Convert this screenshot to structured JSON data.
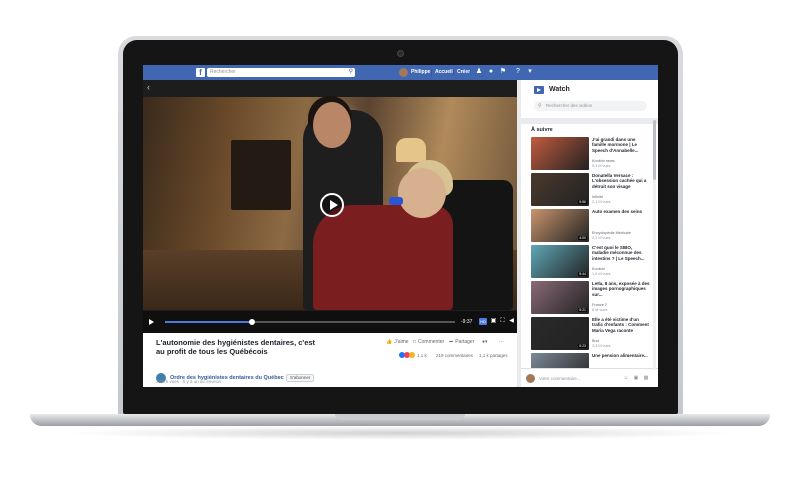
{
  "topbar": {
    "logo": "f",
    "search_placeholder": "Rechercher",
    "user_name": "Philippe",
    "home_label": "Accueil",
    "create_label": "Créer"
  },
  "player": {
    "time_remaining": "-9:37",
    "progress": 0.3
  },
  "video": {
    "title": "L'autonomie des hygiénistes dentaires, c'est au profit de tous les Québécois",
    "like_label": "J'aime",
    "comment_label": "Commenter",
    "share_label": "Partager",
    "reactions_count": "1,1 k",
    "comments_count": "219 commentaires",
    "shares_count": "1,1 k partages",
    "page_name": "Ordre des hygiénistes dentaires du Québec",
    "subscribe_label": "S'abonner",
    "meta": "22,8 k vues · Il y a un an environ · "
  },
  "watch": {
    "title": "Watch",
    "search_placeholder": "Rechercher des vidéos",
    "next_label": "À suivre",
    "comment_placeholder": "Votre commentaire..."
  },
  "up_next": [
    {
      "title": "J'ai grandi dans une famille mormone | Le Speech d'Annabelle...",
      "source": "Konbini news",
      "views": "5,3 M vues",
      "duration": "",
      "thumb": "#c25b3f"
    },
    {
      "title": "Donatella Versace : L'obsession cachée qui a détruit son visage",
      "source": "Infinite",
      "views": "2,1 M vues",
      "duration": "5:56",
      "thumb": "#4a3a2e"
    },
    {
      "title": "Auto examen des seins",
      "source": "Encyclopédie Médicale",
      "views": "2,1 M vues",
      "duration": "4:00",
      "thumb": "#c9956d"
    },
    {
      "title": "C'est quoi le SIBO, maladie méconnue des intestins ? | Le Speech...",
      "source": "Konbini",
      "views": "1,9 M vues",
      "duration": "5:44",
      "thumb": "#5fa8b8"
    },
    {
      "title": "Leïla, 8 ans, exposée à des images pornographiques sur...",
      "source": "France 2",
      "views": "8 M vues",
      "duration": "5:21",
      "thumb": "#8a6a78"
    },
    {
      "title": "Elle a été victime d'un trafic d'enfants : Comment Maria Vega raconte",
      "source": "Brut",
      "views": "3,3 M vues",
      "duration": "5:23",
      "thumb": "#2a2a2a"
    },
    {
      "title": "Une pension alimentaire...",
      "source": "",
      "views": "",
      "duration": "",
      "thumb": "#7c8a99"
    }
  ],
  "colors": {
    "facebook_blue": "#4267b2",
    "link_blue": "#365899",
    "progress_blue": "#4a7be0"
  },
  "icons": {
    "topbar": [
      "friends-icon",
      "messenger-icon",
      "notifications-icon",
      "help-icon",
      "dropdown-icon"
    ],
    "controls": [
      "play-icon",
      "settings-icon",
      "fullscreen-icon",
      "volume-icon"
    ]
  }
}
